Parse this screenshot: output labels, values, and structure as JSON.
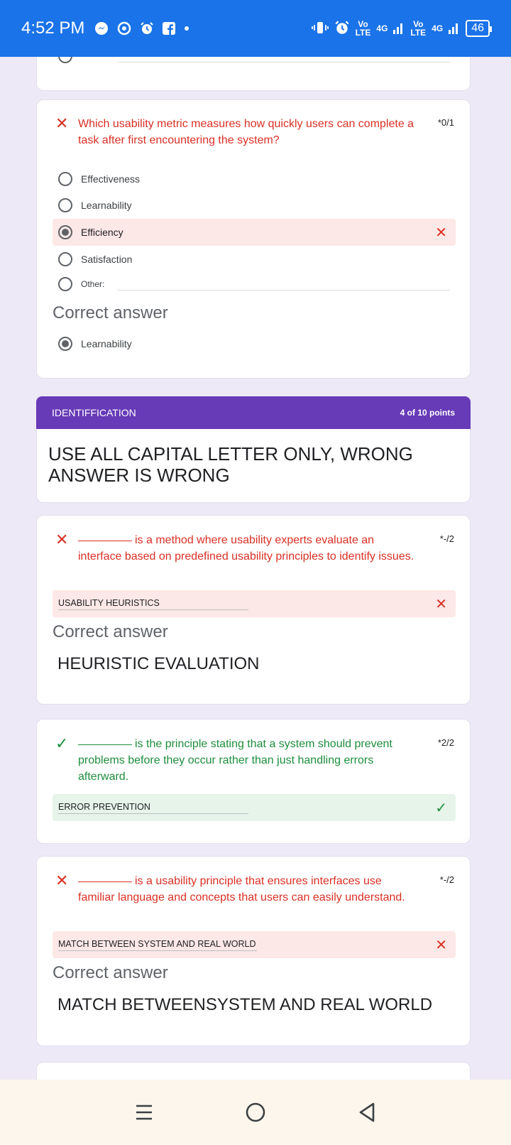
{
  "status_bar": {
    "time": "4:52 PM",
    "left_icons": [
      "messenger-icon",
      "chrome-icon",
      "alarm-icon",
      "facebook-icon",
      "dot-icon"
    ],
    "sim1_top": "Vo",
    "sim1_bottom": "LTE",
    "sim1_net": "4G",
    "sim2_top": "Vo",
    "sim2_bottom": "LTE",
    "sim2_net": "4G",
    "battery": "46"
  },
  "q_usability": {
    "question": "Which usability metric measures how quickly users can complete a task after first encountering the system?",
    "points": "*0/1",
    "options": [
      "Effectiveness",
      "Learnability",
      "Efficiency",
      "Satisfaction",
      "Other:"
    ],
    "correct_label": "Correct answer",
    "correct_answer": "Learnability"
  },
  "section": {
    "title": "IDENTIFFICATION",
    "points": "4 of 10 points",
    "description": "USE ALL CAPITAL LETTER ONLY, WRONG ANSWER IS WRONG"
  },
  "q_heuristic": {
    "question": "is a method where usability experts evaluate an interface based on predefined usability principles to identify issues.",
    "points": "*-/2",
    "answer": "USABILITY HEURISTICS",
    "correct_label": "Correct answer",
    "correct_answer": "HEURISTIC EVALUATION"
  },
  "q_error": {
    "question": "is the principle stating that a system should prevent problems before they occur rather than just handling errors afterward.",
    "points": "*2/2",
    "answer": "ERROR PREVENTION"
  },
  "q_match": {
    "question": "is a usability principle that ensures interfaces use familiar language and concepts that users can easily understand.",
    "points": "*-/2",
    "answer": "MATCH BETWEEN SYSTEM AND REAL WORLD",
    "correct_label": "Correct answer",
    "correct_answer": "MATCH BETWEENSYSTEM AND REAL WORLD"
  },
  "colors": {
    "status_bar": "#1a73e8",
    "section_header": "#673ab7",
    "wrong_bg": "#fce8e6",
    "right_bg": "#e6f4ea",
    "wrong": "#d93025",
    "right": "#1e8e3e",
    "page_bg": "#ede9f6"
  },
  "nav": [
    "menu-icon",
    "home-icon",
    "back-icon"
  ]
}
